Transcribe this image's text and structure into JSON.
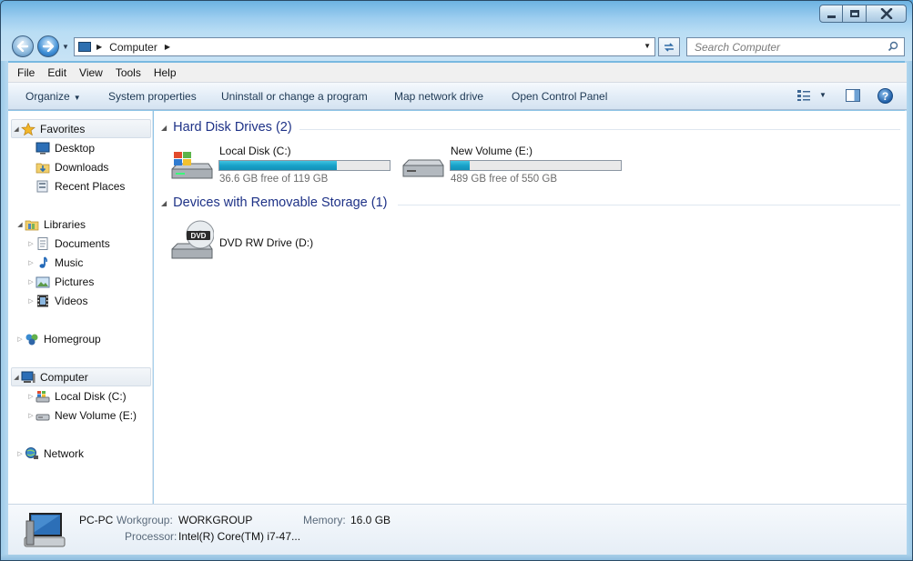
{
  "window": {
    "minimize_icon": "minimize-icon",
    "maximize_icon": "maximize-icon",
    "close_icon": "close-icon"
  },
  "address_bar": {
    "location": "Computer",
    "search_placeholder": "Search Computer"
  },
  "menu": {
    "items": [
      "File",
      "Edit",
      "View",
      "Tools",
      "Help"
    ]
  },
  "commands": {
    "organize": "Organize",
    "system_properties": "System properties",
    "uninstall": "Uninstall or change a program",
    "map_drive": "Map network drive",
    "control_panel": "Open Control Panel"
  },
  "nav": {
    "favorites": "Favorites",
    "desktop": "Desktop",
    "downloads": "Downloads",
    "recent_places": "Recent Places",
    "libraries": "Libraries",
    "documents": "Documents",
    "music": "Music",
    "pictures": "Pictures",
    "videos": "Videos",
    "homegroup": "Homegroup",
    "computer": "Computer",
    "local_disk": "Local Disk (C:)",
    "new_volume": "New Volume (E:)",
    "network": "Network"
  },
  "content": {
    "hard_disk_header": "Hard Disk Drives (2)",
    "removable_header": "Devices with Removable Storage (1)",
    "drives": [
      {
        "name": "Local Disk (C:)",
        "free_text": "36.6 GB free of 119 GB",
        "used_fraction": 0.69
      },
      {
        "name": "New Volume (E:)",
        "free_text": "489 GB free of 550 GB",
        "used_fraction": 0.11
      }
    ],
    "dvd": {
      "name": "DVD RW Drive (D:)",
      "label": "DVD"
    }
  },
  "details": {
    "pc_name": "PC-PC",
    "workgroup_label": "Workgroup:",
    "workgroup_value": "WORKGROUP",
    "memory_label": "Memory:",
    "memory_value": "16.0 GB",
    "processor_label": "Processor:",
    "processor_value": "Intel(R) Core(TM) i7-47..."
  },
  "colors": {
    "group_header": "#1e3287",
    "bar_fill": "#19a2c9"
  }
}
